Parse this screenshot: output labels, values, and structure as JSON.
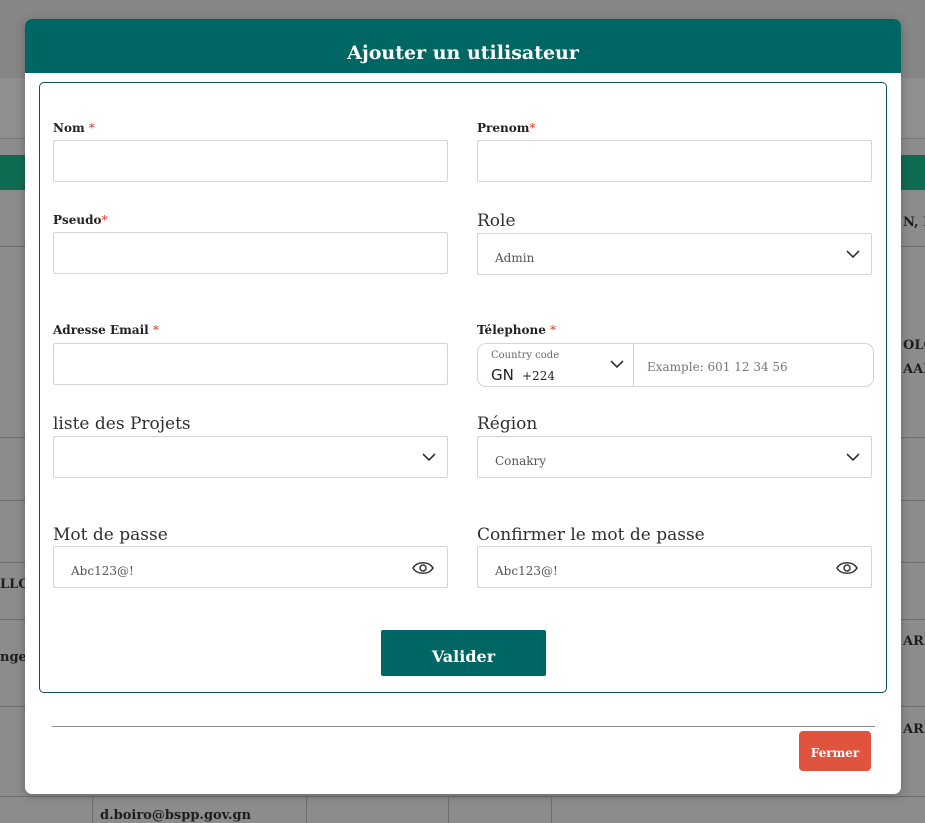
{
  "background": {
    "row_fragments": [
      {
        "text": "N, P"
      },
      {
        "text": "OLO"
      },
      {
        "text": "AAB"
      },
      {
        "text": "LLO"
      },
      {
        "text": "ngel"
      },
      {
        "text": "ARI"
      },
      {
        "text": "ARI"
      },
      {
        "text": "d.boiro@bspp.gov.gn"
      }
    ]
  },
  "modal": {
    "title": "Ajouter un utilisateur",
    "fields": {
      "nom": {
        "label": "Nom ",
        "required_mark": "*",
        "value": ""
      },
      "prenom": {
        "label": "Prenom",
        "required_mark": "*",
        "value": ""
      },
      "pseudo": {
        "label": "Pseudo",
        "required_mark": "*",
        "value": ""
      },
      "role": {
        "label": "Role",
        "selected": "Admin"
      },
      "email": {
        "label": "Adresse Email ",
        "required_mark": "*",
        "value": ""
      },
      "telephone": {
        "label": "Télephone ",
        "required_mark": "*",
        "country_code_label": "Country code",
        "country_iso": "GN",
        "dial_code": "+224",
        "placeholder": "Example: 601 12 34 56"
      },
      "projets": {
        "label": "liste des Projets",
        "selected": ""
      },
      "region": {
        "label": "Région",
        "selected": "Conakry"
      },
      "password": {
        "label": "Mot de passe",
        "placeholder": "Abc123@!"
      },
      "confirm_password": {
        "label": "Confirmer le mot de passe",
        "placeholder": "Abc123@!"
      }
    },
    "submit_label": "Valider",
    "close_label": "Fermer"
  },
  "colors": {
    "primary": "#006663",
    "danger": "#e0543f",
    "required": "#e0352b"
  },
  "icons": {
    "dropdown": "chevron-down-icon",
    "password_toggle": "eye-icon"
  }
}
